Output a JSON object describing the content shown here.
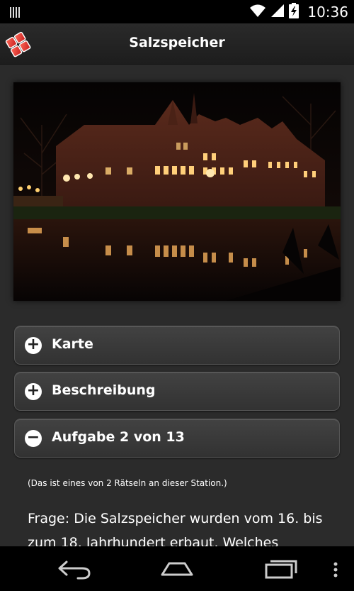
{
  "status_bar": {
    "time": "10:36",
    "icons": [
      "signal-bars-icon",
      "wifi-icon",
      "cell-signal-icon",
      "battery-charging-icon"
    ]
  },
  "action_bar": {
    "title": "Salzspeicher",
    "logo_icon": "app-logo-icon"
  },
  "photo": {
    "subject": "Salzspeicher"
  },
  "sections": [
    {
      "label": "Karte",
      "icon": "plus-icon",
      "symbol": "+"
    },
    {
      "label": "Beschreibung",
      "icon": "plus-icon",
      "symbol": "+"
    },
    {
      "label": "Aufgabe 2 von 13",
      "icon": "minus-icon",
      "symbol": "−"
    }
  ],
  "task": {
    "note": "(Das ist eines von 2 Rätseln an dieser Station.)",
    "question": "Frage: Die Salzspeicher wurden vom 16. bis zum 18. Jahrhundert erbaut. Welches"
  },
  "nav_bar": {
    "icons": [
      "back-icon",
      "home-icon",
      "recent-apps-icon",
      "overflow-menu-icon"
    ]
  },
  "colors": {
    "status_bar": "#000000",
    "action_bar": "#222222",
    "background": "#2b2b2b",
    "logo_red": "#e8322c"
  }
}
